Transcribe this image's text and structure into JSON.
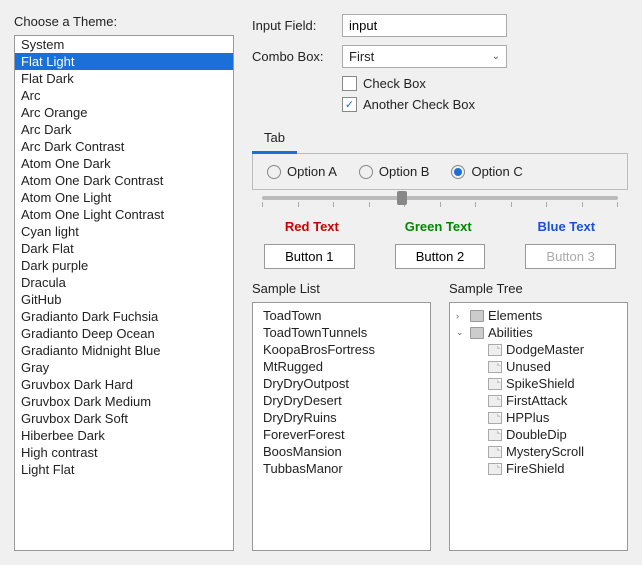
{
  "left": {
    "label": "Choose a Theme:",
    "selected": "Flat Light",
    "themes": [
      "System",
      "Flat Light",
      "Flat Dark",
      "Arc",
      "Arc Orange",
      "Arc Dark",
      "Arc Dark Contrast",
      "Atom One Dark",
      "Atom One Dark Contrast",
      "Atom One Light",
      "Atom One Light Contrast",
      "Cyan light",
      "Dark Flat",
      "Dark purple",
      "Dracula",
      "GitHub",
      "Gradianto Dark Fuchsia",
      "Gradianto Deep Ocean",
      "Gradianto Midnight Blue",
      "Gray",
      "Gruvbox Dark Hard",
      "Gruvbox Dark Medium",
      "Gruvbox Dark Soft",
      "Hiberbee Dark",
      "High contrast",
      "Light Flat"
    ]
  },
  "form": {
    "input_label": "Input Field:",
    "input_value": "input",
    "combo_label": "Combo Box:",
    "combo_value": "First",
    "check1": {
      "label": "Check Box",
      "checked": false
    },
    "check2": {
      "label": "Another Check Box",
      "checked": true
    }
  },
  "tabs": {
    "label": "Tab"
  },
  "radios": {
    "options": [
      "Option A",
      "Option B",
      "Option C"
    ],
    "selected": "Option C"
  },
  "colored": {
    "red": "Red Text",
    "green": "Green Text",
    "blue": "Blue Text"
  },
  "buttons": {
    "b1": "Button 1",
    "b2": "Button 2",
    "b3": "Button 3"
  },
  "sample_list": {
    "label": "Sample List",
    "items": [
      "ToadTown",
      "ToadTownTunnels",
      "KoopaBrosFortress",
      "MtRugged",
      "DryDryOutpost",
      "DryDryDesert",
      "DryDryRuins",
      "ForeverForest",
      "BoosMansion",
      "TubbasManor"
    ]
  },
  "sample_tree": {
    "label": "Sample Tree",
    "nodes": [
      {
        "name": "Elements",
        "expanded": false,
        "children": []
      },
      {
        "name": "Abilities",
        "expanded": true,
        "children": [
          "DodgeMaster",
          "Unused",
          "SpikeShield",
          "FirstAttack",
          "HPPlus",
          "DoubleDip",
          "MysteryScroll",
          "FireShield"
        ]
      }
    ]
  }
}
